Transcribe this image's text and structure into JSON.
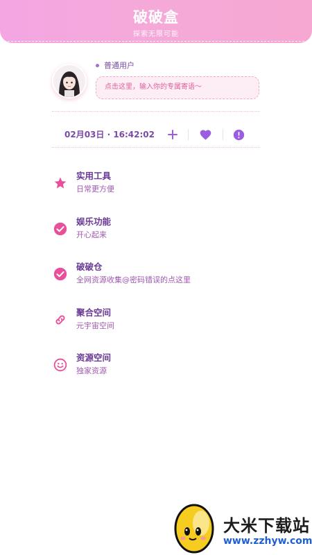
{
  "header": {
    "title": "破破盒",
    "subtitle": "探索无限可能"
  },
  "profile": {
    "user_type": "普通用户",
    "motto_placeholder": "点击这里，输入你的专属寄语～"
  },
  "action_bar": {
    "datetime": "02月03日 · 16:42:02",
    "add_icon": "plus-icon",
    "favorite_icon": "heart-icon",
    "info_icon": "alert-circle-icon"
  },
  "menu": {
    "items": [
      {
        "title": "实用工具",
        "desc": "日常更方便",
        "icon": "star-icon"
      },
      {
        "title": "娱乐功能",
        "desc": "开心起来",
        "icon": "check-circle-icon"
      },
      {
        "title": "破破仓",
        "desc": "全网资源收集@密码错误的点这里",
        "icon": "check-circle-icon"
      },
      {
        "title": "聚合空间",
        "desc": "元宇宙空间",
        "icon": "link-icon"
      },
      {
        "title": "资源空间",
        "desc": "独家资源",
        "icon": "smile-icon"
      }
    ]
  },
  "colors": {
    "header_gradient_start": "#f3a6e2",
    "header_gradient_end": "#f6a8d2",
    "accent_pink": "#e8509a",
    "accent_purple": "#9b5de0",
    "title_purple": "#6a3a95"
  },
  "watermark": {
    "name": "大米下载站",
    "url": "www.zzhyw.com"
  }
}
